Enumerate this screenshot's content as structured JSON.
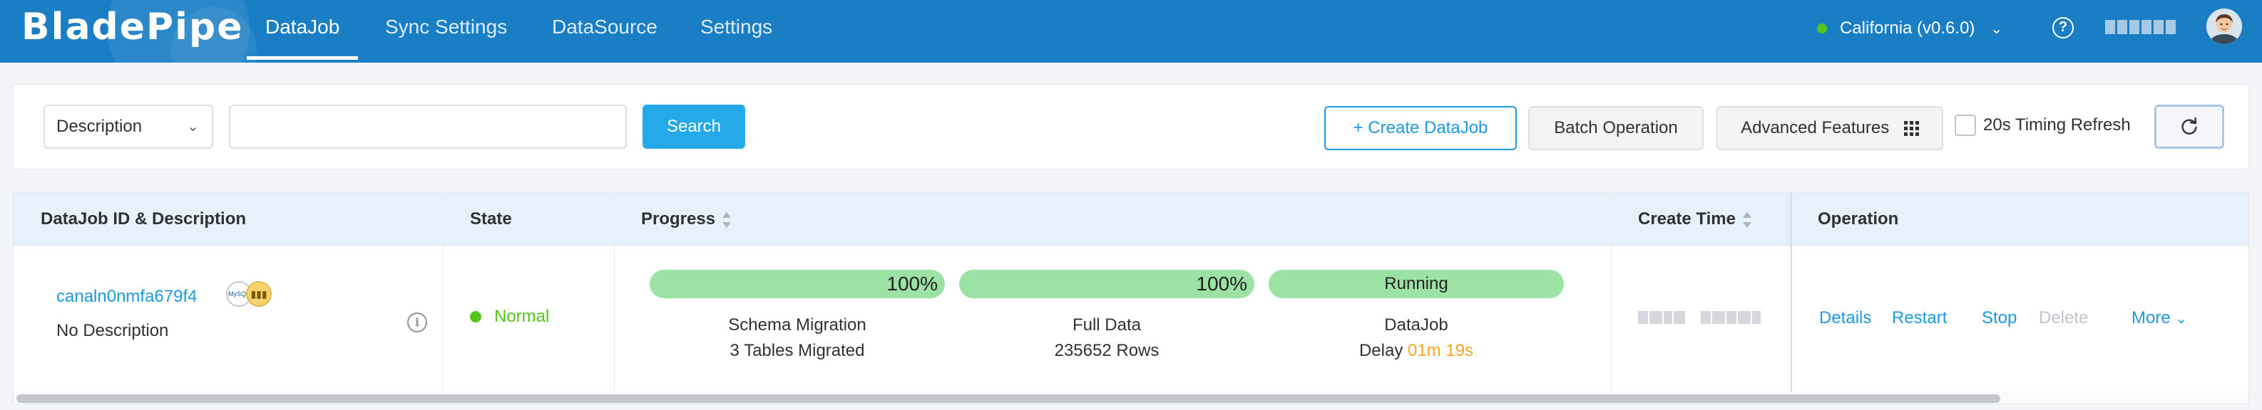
{
  "topbar": {
    "logo": "BladePipe",
    "nav": [
      {
        "label": "DataJob",
        "active": true
      },
      {
        "label": "Sync Settings",
        "active": false
      },
      {
        "label": "DataSource",
        "active": false
      },
      {
        "label": "Settings",
        "active": false
      }
    ],
    "region": "California (v0.6.0)",
    "help": "?",
    "brand_color": "#1a7ec5"
  },
  "toolbar": {
    "filter_select": "Description",
    "search_value": "",
    "search_button": "Search",
    "create_button": "+ Create DataJob",
    "batch_button": "Batch Operation",
    "advanced_button": "Advanced Features",
    "timing_refresh_label": "20s Timing Refresh",
    "timing_refresh_checked": false
  },
  "table": {
    "headers": {
      "id_desc": "DataJob ID & Description",
      "state": "State",
      "progress": "Progress",
      "create_time": "Create Time",
      "operation": "Operation"
    },
    "rows": [
      {
        "job_id": "canaln0nmfa679f4",
        "source_icons": [
          "mysql-icon",
          "clickhouse-icon"
        ],
        "description": "No Description",
        "state": "Normal",
        "state_color": "#52c41a",
        "progress": [
          {
            "kind": "percent",
            "value": 100,
            "label": "100%",
            "stage": "Schema Migration",
            "info": "3 Tables Migrated"
          },
          {
            "kind": "percent",
            "value": 100,
            "label": "100%",
            "stage": "Full Data",
            "info": "235652 Rows"
          },
          {
            "kind": "status",
            "value": 1.0,
            "label": "Running",
            "stage": "DataJob",
            "info_prefix": "Delay",
            "info_value": "01m 19s"
          }
        ],
        "operations": [
          {
            "label": "Details",
            "enabled": true
          },
          {
            "label": "Restart",
            "enabled": true
          },
          {
            "label": "Stop",
            "enabled": true
          },
          {
            "label": "Delete",
            "enabled": false
          },
          {
            "label": "More",
            "enabled": true
          }
        ]
      }
    ]
  },
  "colors": {
    "accent": "#1b9ae0",
    "primary_button": "#26a9e8",
    "progress_fill": "#9de2a5",
    "delay": "#f5a623",
    "disabled": "#c0c4cc"
  }
}
